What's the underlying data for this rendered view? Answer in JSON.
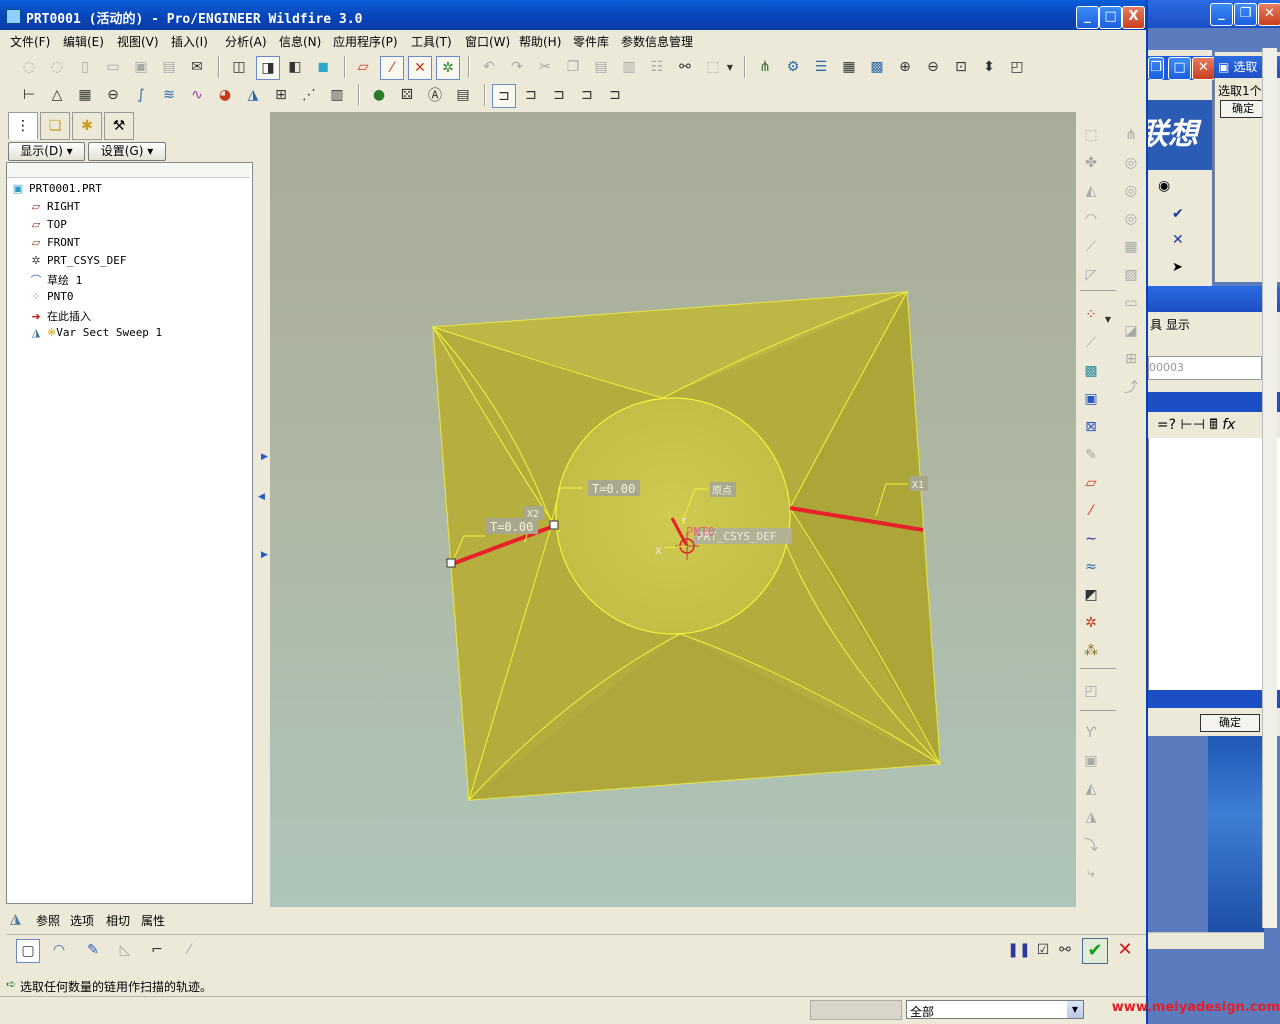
{
  "window": {
    "title": "PRT0001 (活动的) - Pro/ENGINEER Wildfire 3.0",
    "controls": [
      "_",
      "□",
      "X"
    ]
  },
  "menu": [
    "文件(F)",
    "编辑(E)",
    "视图(V)",
    "插入(I)",
    "分析(A)",
    "信息(N)",
    "应用程序(P)",
    "工具(T)",
    "窗口(W)",
    "帮助(H)",
    "零件库",
    "参数信息管理"
  ],
  "left_panel": {
    "show_button": "显示(D) ▾",
    "settings_button": "设置(G) ▾",
    "tree": [
      {
        "label": "PRT0001.PRT",
        "icon": "part-icon"
      },
      {
        "label": "RIGHT",
        "icon": "datum-plane-icon"
      },
      {
        "label": "TOP",
        "icon": "datum-plane-icon"
      },
      {
        "label": "FRONT",
        "icon": "datum-plane-icon"
      },
      {
        "label": "PRT_CSYS_DEF",
        "icon": "csys-icon"
      },
      {
        "label": "草绘 1",
        "icon": "sketch-icon"
      },
      {
        "label": "PNT0",
        "icon": "datum-point-icon"
      },
      {
        "label": "在此插入",
        "icon": "insert-here-arrow-icon"
      },
      {
        "label": "Var Sect Sweep 1",
        "icon": "sweep-feature-icon"
      }
    ]
  },
  "viewport": {
    "labels": {
      "t_upper": "T=0.00",
      "t_left": "T=0.00",
      "tag_a": "原点",
      "tag_x2": "X2",
      "tag_x1": "X1",
      "pnt": "PNT0",
      "csys": "PRT_CSYS_DEF",
      "x_axis": "X",
      "y_axis": "Y"
    },
    "colors": {
      "surface": "#b7b040",
      "edge": "#ffff33",
      "trajectory": "#e8202a"
    }
  },
  "dashboard": {
    "tabs": [
      "参照",
      "选项",
      "相切",
      "属性"
    ],
    "status_message": "选取任何数量的链用作扫描的轨迹。"
  },
  "bottom": {
    "filter_value": "全部",
    "watermark": "www.meiyadesign.com"
  },
  "background_window": {
    "title": "选取",
    "prompt": "选取1个",
    "ok1": "确定",
    "toolbar_text": "具 显示",
    "field_text": "00003",
    "ok2": "确定",
    "banner_text": "联想"
  }
}
